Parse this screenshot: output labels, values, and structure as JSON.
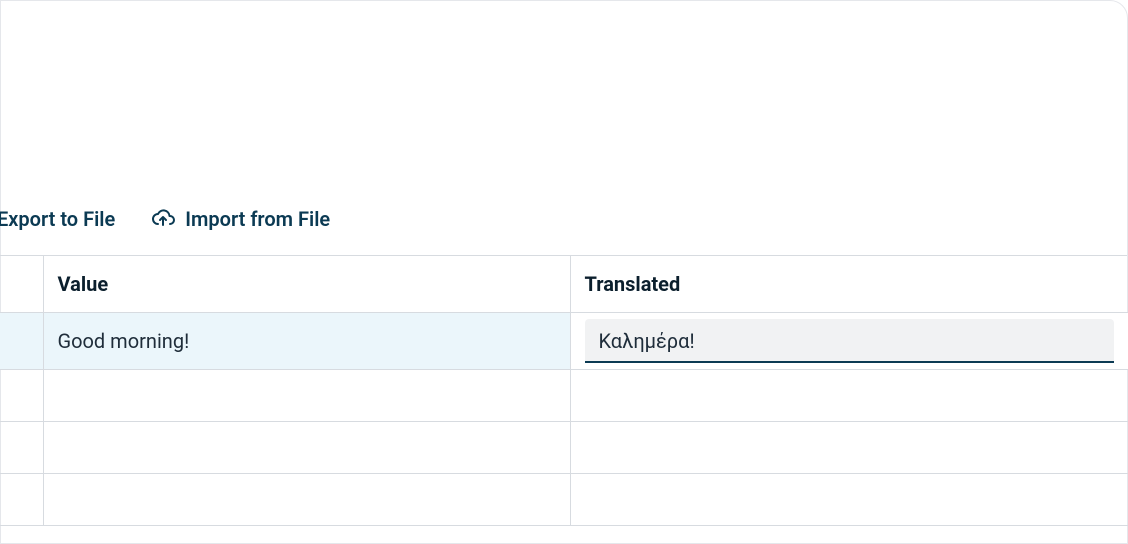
{
  "toolbar": {
    "export_label": "Export to File",
    "import_label": "Import from File"
  },
  "table": {
    "headers": {
      "value": "Value",
      "translated": "Translated"
    },
    "rows": [
      {
        "value": "Good morning!",
        "translated": "Καλημέρα!"
      },
      {
        "value": "",
        "translated": ""
      },
      {
        "value": "",
        "translated": ""
      },
      {
        "value": "",
        "translated": ""
      }
    ]
  }
}
